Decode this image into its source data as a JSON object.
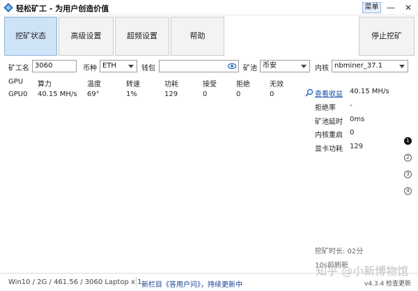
{
  "title": {
    "text": "轻松矿工 - 为用户创造价值"
  },
  "titlebar": {
    "menu": "菜单",
    "minimize": "—",
    "close": "✕"
  },
  "toolbar": {
    "tabs": [
      {
        "label": "挖矿状态",
        "active": true
      },
      {
        "label": "高级设置",
        "active": false
      },
      {
        "label": "超频设置",
        "active": false
      },
      {
        "label": "帮助",
        "active": false
      }
    ],
    "stop_label": "停止挖矿"
  },
  "settings": {
    "miner_name_label": "矿工名",
    "miner_name_value": "3060",
    "coin_label": "币种",
    "coin_value": "ETH",
    "wallet_label": "钱包",
    "wallet_value": "",
    "pool_label": "矿池",
    "pool_value": "币安",
    "kernel_label": "内核",
    "kernel_value": "nbminer_37.1"
  },
  "gpu_table": {
    "headers": [
      "GPU",
      "算力",
      "温度",
      "转速",
      "功耗",
      "接受",
      "拒绝",
      "无效"
    ],
    "rows": [
      [
        "GPU0",
        "40.15 MH/s",
        "69°",
        "1%",
        "129",
        "0",
        "0",
        "0"
      ]
    ]
  },
  "stats": {
    "earnings_link": "查看收益",
    "earnings_value": "40.15 MH/s",
    "rows": [
      {
        "key": "拒绝率",
        "value": "-"
      },
      {
        "key": "矿池延时",
        "value": "0ms"
      },
      {
        "key": "内核重启",
        "value": "0"
      },
      {
        "key": "显卡功耗",
        "value": "129"
      }
    ]
  },
  "pager": [
    "1",
    "2",
    "3",
    "4"
  ],
  "footer": {
    "mining_time": "挖矿时长:  02分",
    "refreshed": "10s前刷新",
    "sys_info": "Win10  / 2G / 461.56 / 3060 Laptop x 1",
    "news": "新栏目《答用户问》，持续更新中",
    "version": "v4.3.4 检查更新",
    "watermark": "知乎 @小新博物馆"
  },
  "colors": {
    "accent": "#cfe3f7",
    "link": "#1a4fa8"
  },
  "icons": {
    "app": "app-logo-icon",
    "eye": "eye-icon",
    "search": "magnifier-icon",
    "dropdown": "chevron-down-icon"
  }
}
